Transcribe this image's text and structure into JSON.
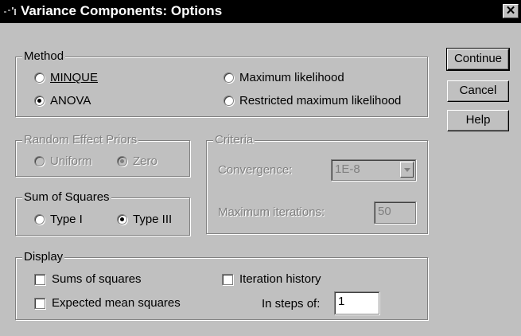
{
  "window": {
    "title": "Variance Components: Options",
    "close_glyph": "✕"
  },
  "method": {
    "legend": "Method",
    "options": [
      {
        "label": "MINQUE",
        "selected": false
      },
      {
        "label": "ANOVA",
        "selected": true
      },
      {
        "label": "Maximum likelihood",
        "selected": false
      },
      {
        "label": "Restricted maximum likelihood",
        "selected": false
      }
    ]
  },
  "buttons": {
    "continue": "Continue",
    "cancel": "Cancel",
    "help": "Help"
  },
  "random_effect_priors": {
    "legend": "Random Effect Priors",
    "options": [
      {
        "label": "Uniform",
        "selected": false
      },
      {
        "label": "Zero",
        "selected": true
      }
    ]
  },
  "criteria": {
    "legend": "Criteria",
    "convergence_label": "Convergence:",
    "convergence_value": "1E-8",
    "max_iterations_label": "Maximum iterations:",
    "max_iterations_value": "50"
  },
  "sum_of_squares": {
    "legend": "Sum of Squares",
    "options": [
      {
        "label": "Type I",
        "selected": false
      },
      {
        "label": "Type III",
        "selected": true
      }
    ]
  },
  "display": {
    "legend": "Display",
    "sums_of_squares": "Sums of squares",
    "expected_mean_squares": "Expected mean squares",
    "iteration_history": "Iteration history",
    "in_steps_of_label": "In steps of:",
    "in_steps_of_value": "1"
  }
}
